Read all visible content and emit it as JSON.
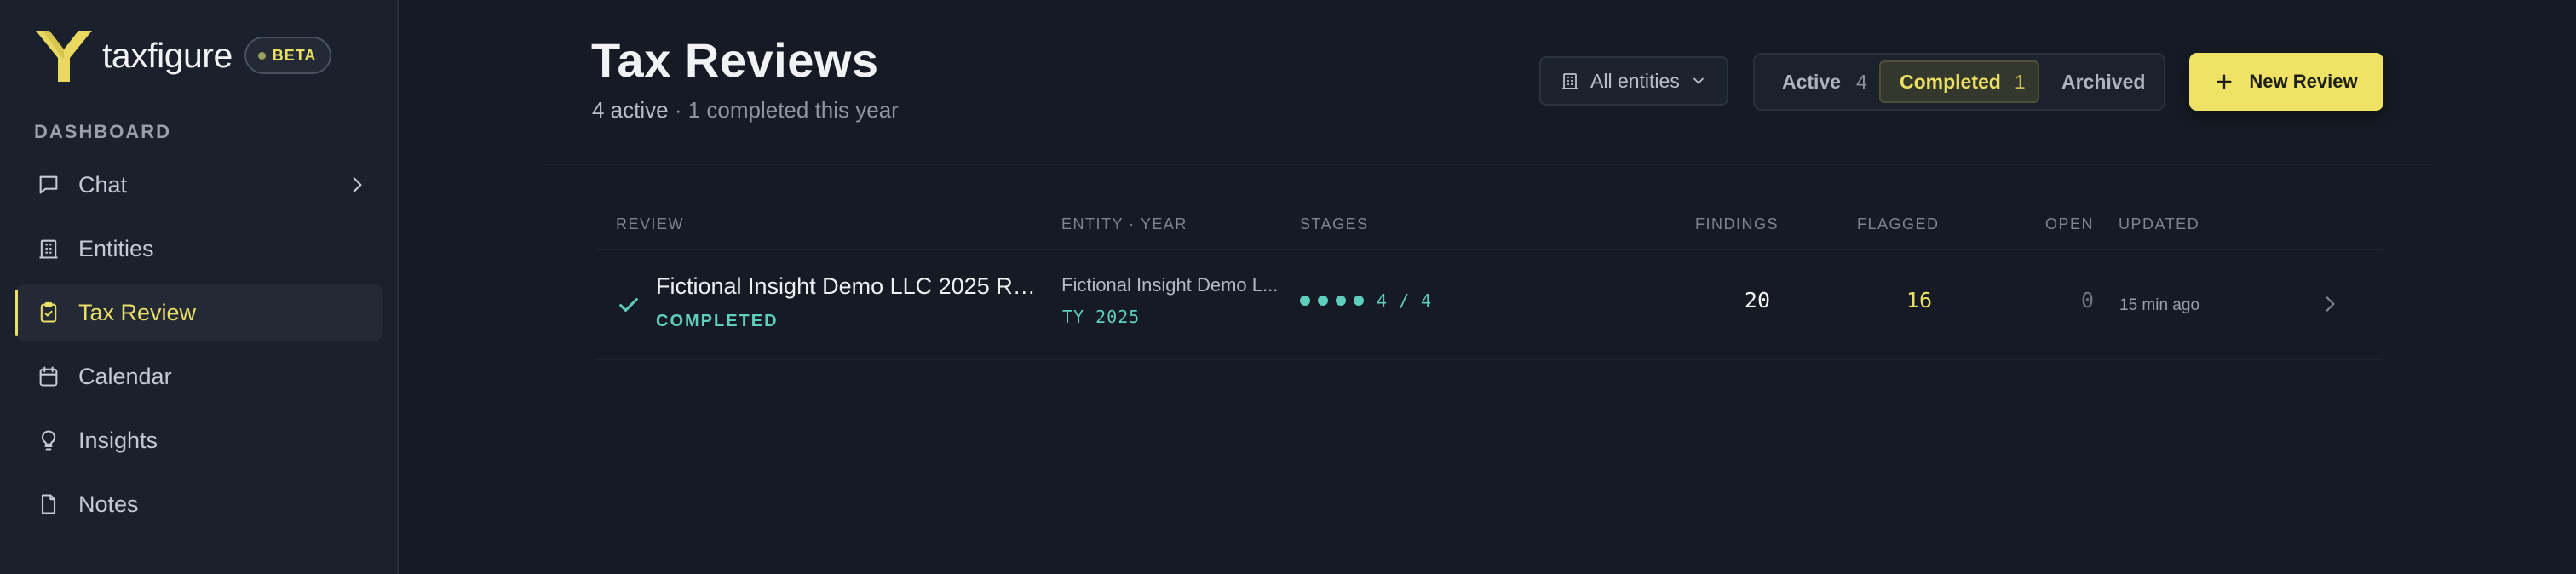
{
  "brand": {
    "name": "taxfigure",
    "badge": "BETA",
    "accent": "#efe264"
  },
  "sidebar": {
    "section_label": "DASHBOARD",
    "items": [
      {
        "label": "Chat",
        "icon": "chat-icon",
        "active": false,
        "has_chevron": true
      },
      {
        "label": "Entities",
        "icon": "building-icon",
        "active": false
      },
      {
        "label": "Tax Review",
        "icon": "clipboard-check-icon",
        "active": true
      },
      {
        "label": "Calendar",
        "icon": "calendar-icon",
        "active": false
      },
      {
        "label": "Insights",
        "icon": "lightbulb-icon",
        "active": false
      },
      {
        "label": "Notes",
        "icon": "note-icon",
        "active": false
      }
    ]
  },
  "header": {
    "title": "Tax Reviews",
    "subtitle_strong": "4 active",
    "subtitle_rest": " · 1 completed this year",
    "entity_filter": "All entities",
    "tabs": [
      {
        "label": "Active",
        "count": "4"
      },
      {
        "label": "Completed",
        "count": "1",
        "selected": true
      },
      {
        "label": "Archived"
      }
    ],
    "new_button": "New Review"
  },
  "table": {
    "columns": {
      "review": "REVIEW",
      "entity_year": "ENTITY · YEAR",
      "stages": "STAGES",
      "findings": "FINDINGS",
      "flagged": "FLAGGED",
      "open": "OPEN",
      "updated": "UPDATED"
    },
    "rows": [
      {
        "title": "Fictional Insight Demo LLC 2025 Revi...",
        "status": "COMPLETED",
        "entity": "Fictional Insight Demo L...",
        "year": "TY 2025",
        "stages_done": 4,
        "stages_total": 4,
        "stages_text": "4 / 4",
        "findings": "20",
        "flagged": "16",
        "open": "0",
        "updated": "15 min ago"
      }
    ]
  },
  "colors": {
    "background": "#151a24",
    "sidebar": "#1b212c",
    "accent_yellow": "#efe264",
    "teal": "#5fcfbd"
  }
}
